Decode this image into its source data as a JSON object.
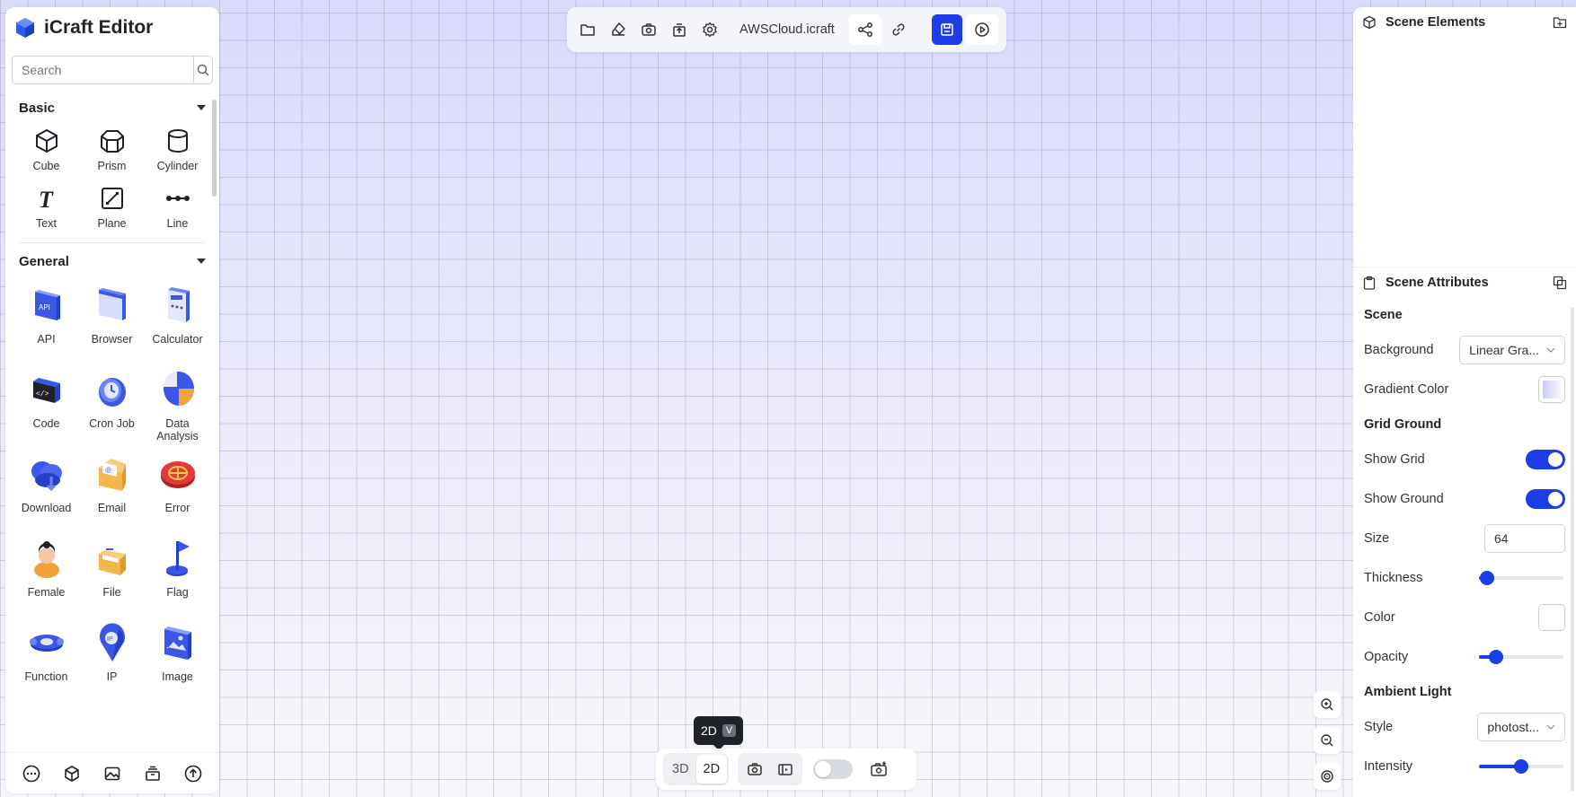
{
  "app": {
    "title": "iCraft Editor"
  },
  "search": {
    "placeholder": "Search"
  },
  "categories": {
    "basic": {
      "label": "Basic",
      "items": [
        "Cube",
        "Prism",
        "Cylinder",
        "Text",
        "Plane",
        "Line"
      ]
    },
    "general": {
      "label": "General",
      "items": [
        "API",
        "Browser",
        "Calculator",
        "Code",
        "Cron Job",
        "Data Analysis",
        "Download",
        "Email",
        "Error",
        "Female",
        "File",
        "Flag",
        "Function",
        "IP",
        "Image"
      ]
    }
  },
  "toolbar": {
    "filename": "AWSCloud.icraft"
  },
  "right": {
    "elements_title": "Scene Elements",
    "attributes_title": "Scene Attributes",
    "scene_label": "Scene",
    "background_label": "Background",
    "background_value": "Linear Gra...",
    "gradient_label": "Gradient Color",
    "grid_ground_label": "Grid Ground",
    "show_grid_label": "Show Grid",
    "show_ground_label": "Show Ground",
    "size_label": "Size",
    "size_value": "64",
    "thickness_label": "Thickness",
    "thickness_value": 0.1,
    "color_label": "Color",
    "opacity_label": "Opacity",
    "opacity_value": 0.2,
    "ambient_label": "Ambient Light",
    "style_label": "Style",
    "style_value": "photost...",
    "intensity_label": "Intensity",
    "intensity_value": 0.5
  },
  "bottom": {
    "mode_3d": "3D",
    "mode_2d": "2D",
    "tooltip_label": "2D",
    "tooltip_key": "V"
  },
  "colors": {
    "accent": "#1d3de6",
    "gradient_swatch": "#d9dafc"
  }
}
